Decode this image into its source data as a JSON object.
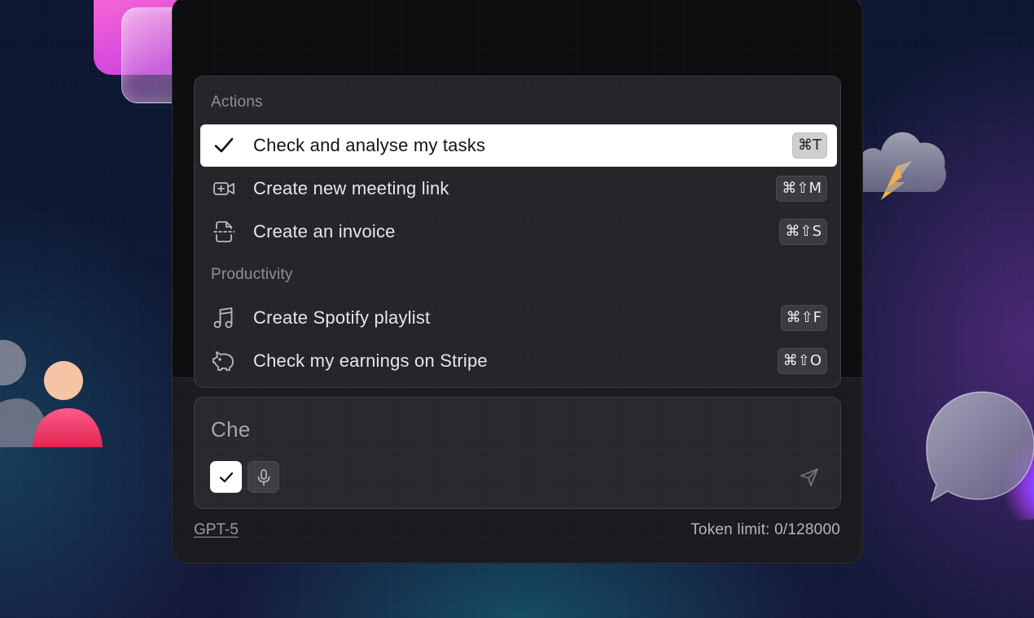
{
  "colors": {
    "window_bg": "#0d0d0f",
    "menu_bg": "#252529",
    "selected_bg": "#ffffff",
    "accent_pink": "#ff6ad5",
    "accent_orange": "#f5a623"
  },
  "menu": {
    "sections": [
      {
        "label": "Actions",
        "items": [
          {
            "label": "Check and analyse my tasks",
            "shortcut": "⌘T",
            "icon": "check-icon",
            "selected": true
          },
          {
            "label": "Create new meeting link",
            "shortcut": "⌘⇧M",
            "icon": "video-plus-icon",
            "selected": false
          },
          {
            "label": "Create an invoice",
            "shortcut": "⌘⇧S",
            "icon": "invoice-icon",
            "selected": false
          }
        ]
      },
      {
        "label": "Productivity",
        "items": [
          {
            "label": "Create Spotify playlist",
            "shortcut": "⌘⇧F",
            "icon": "music-note-icon",
            "selected": false
          },
          {
            "label": "Check my earnings on Stripe",
            "shortcut": "⌘⇧O",
            "icon": "piggy-bank-icon",
            "selected": false
          }
        ]
      }
    ]
  },
  "composer": {
    "value": "Che",
    "buttons": [
      "check-icon",
      "microphone-icon",
      "send-icon"
    ]
  },
  "footer": {
    "model": "GPT-5",
    "token_limit": "Token limit: 0/128000"
  }
}
